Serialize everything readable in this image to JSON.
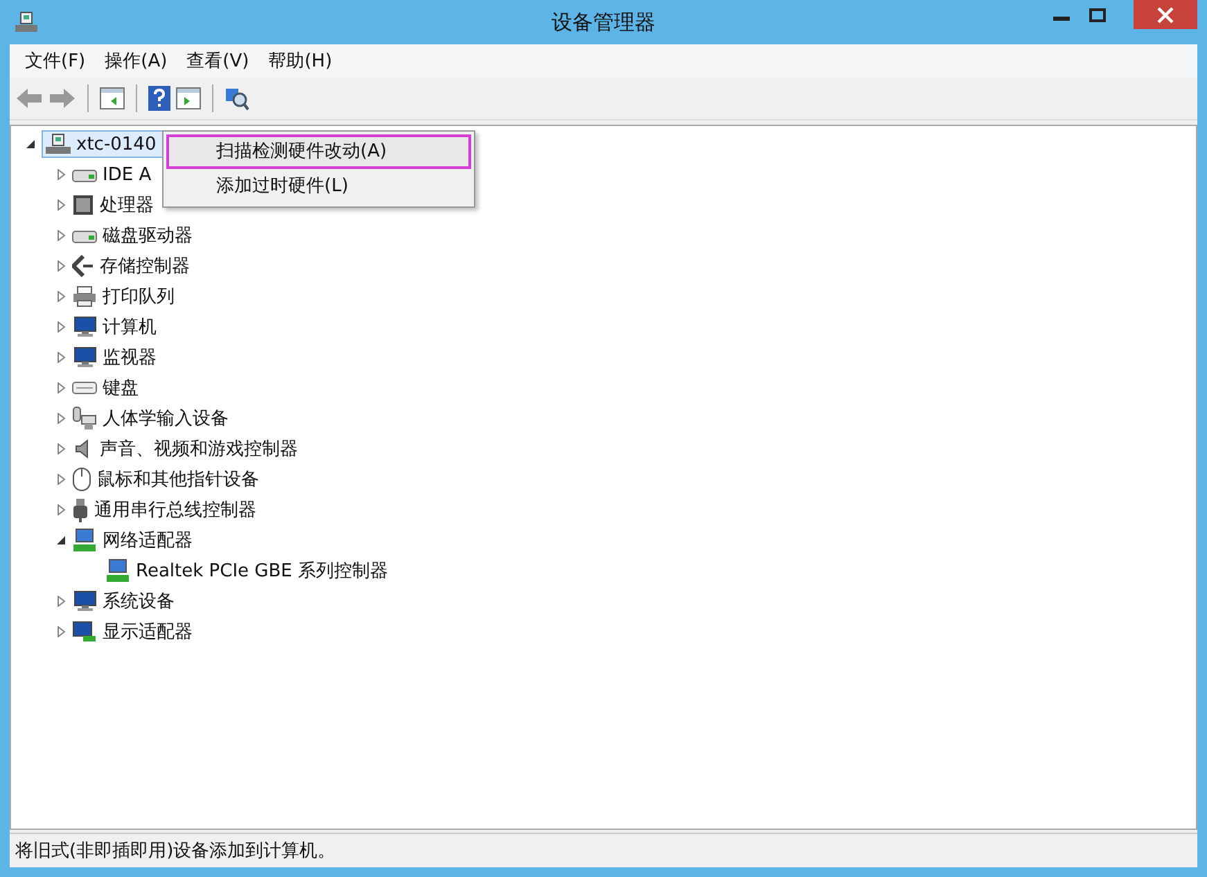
{
  "window": {
    "title": "设备管理器"
  },
  "menu_bar": [
    "文件(F)",
    "操作(A)",
    "查看(V)",
    "帮助(H)"
  ],
  "tree": [
    {
      "label": "xtc-0140",
      "expanded": true,
      "selected": true,
      "children": [
        {
          "label": "IDE A",
          "expanded": false
        },
        {
          "label": "处理器",
          "expanded": false
        },
        {
          "label": "磁盘驱动器",
          "expanded": false
        },
        {
          "label": "存储控制器",
          "expanded": false
        },
        {
          "label": "打印队列",
          "expanded": false
        },
        {
          "label": "计算机",
          "expanded": false
        },
        {
          "label": "监视器",
          "expanded": false
        },
        {
          "label": "键盘",
          "expanded": false
        },
        {
          "label": "人体学输入设备",
          "expanded": false
        },
        {
          "label": "声音、视频和游戏控制器",
          "expanded": false
        },
        {
          "label": "鼠标和其他指针设备",
          "expanded": false
        },
        {
          "label": "通用串行总线控制器",
          "expanded": false
        },
        {
          "label": "网络适配器",
          "expanded": true,
          "children": [
            {
              "label": "Realtek PCIe GBE 系列控制器"
            }
          ]
        },
        {
          "label": "系统设备",
          "expanded": false
        },
        {
          "label": "显示适配器",
          "expanded": false
        }
      ]
    }
  ],
  "context_menu": [
    {
      "label": "扫描检测硬件改动(A)",
      "highlighted": true
    },
    {
      "label": "添加过时硬件(L)",
      "highlighted": false
    }
  ],
  "status_bar": "将旧式(非即插即用)设备添加到计算机。"
}
